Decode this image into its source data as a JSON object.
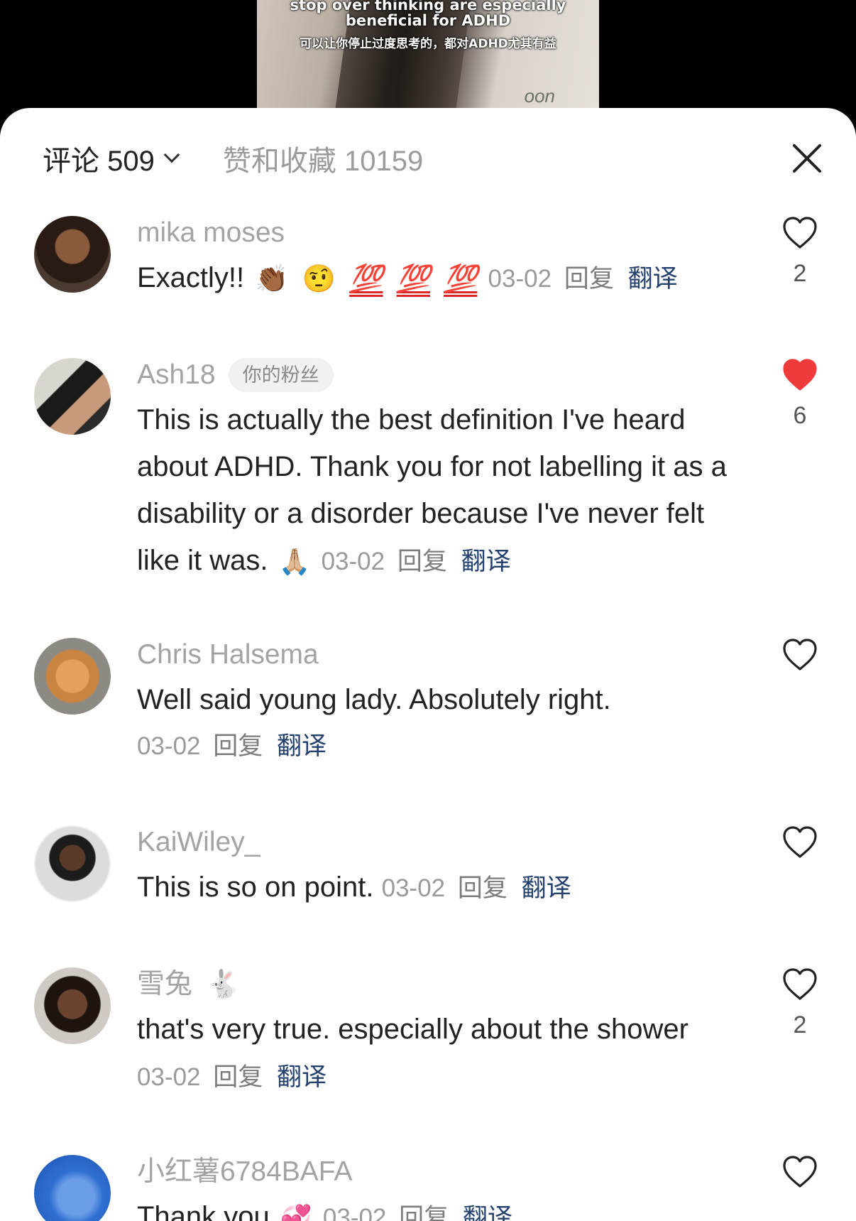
{
  "video": {
    "caption_en": "stop over thinking are especially beneficial for ADHD",
    "caption_zh": "可以让你停止过度思考的，都对ADHD尤其有益",
    "watermark": "oon"
  },
  "header": {
    "comments_label": "评论 509",
    "likes_label": "赞和收藏 10159"
  },
  "comments": [
    {
      "username": "mika moses",
      "text": "Exactly!!",
      "emojis": [
        "👏🏾",
        "🤨"
      ],
      "hundreds": [
        "💯",
        "💯",
        "💯"
      ],
      "date": "03-02",
      "reply": "回复",
      "translate": "翻译",
      "likes": "2",
      "liked": false
    },
    {
      "username": "Ash18",
      "badge": "你的粉丝",
      "text": "This is actually the best definition I've heard about ADHD. Thank you for not labelling it as a disability or a disorder because I've never felt like it was.",
      "emoji": "🙏🏼",
      "date": "03-02",
      "reply": "回复",
      "translate": "翻译",
      "likes": "6",
      "liked": true
    },
    {
      "username": "Chris Halsema",
      "text": "Well said young lady. Absolutely right.",
      "date": "03-02",
      "reply": "回复",
      "translate": "翻译",
      "likes": "",
      "liked": false
    },
    {
      "username": "KaiWiley_",
      "text": "This is so on point.",
      "date": "03-02",
      "reply": "回复",
      "translate": "翻译",
      "likes": "",
      "liked": false
    },
    {
      "username": "雪兔",
      "username_emoji": "🐇",
      "text": "that's very true. especially about the shower",
      "date": "03-02",
      "reply": "回复",
      "translate": "翻译",
      "likes": "2",
      "liked": false
    },
    {
      "username": "小红薯6784BAFA",
      "text": "Thank you",
      "emoji": "💞",
      "date": "03-02",
      "reply": "回复",
      "translate": "翻译",
      "likes": "",
      "liked": false
    }
  ],
  "colors": {
    "liked_heart": "#ef3b3b",
    "translate_link": "#23406e",
    "meta_gray": "#9a9a9a"
  }
}
